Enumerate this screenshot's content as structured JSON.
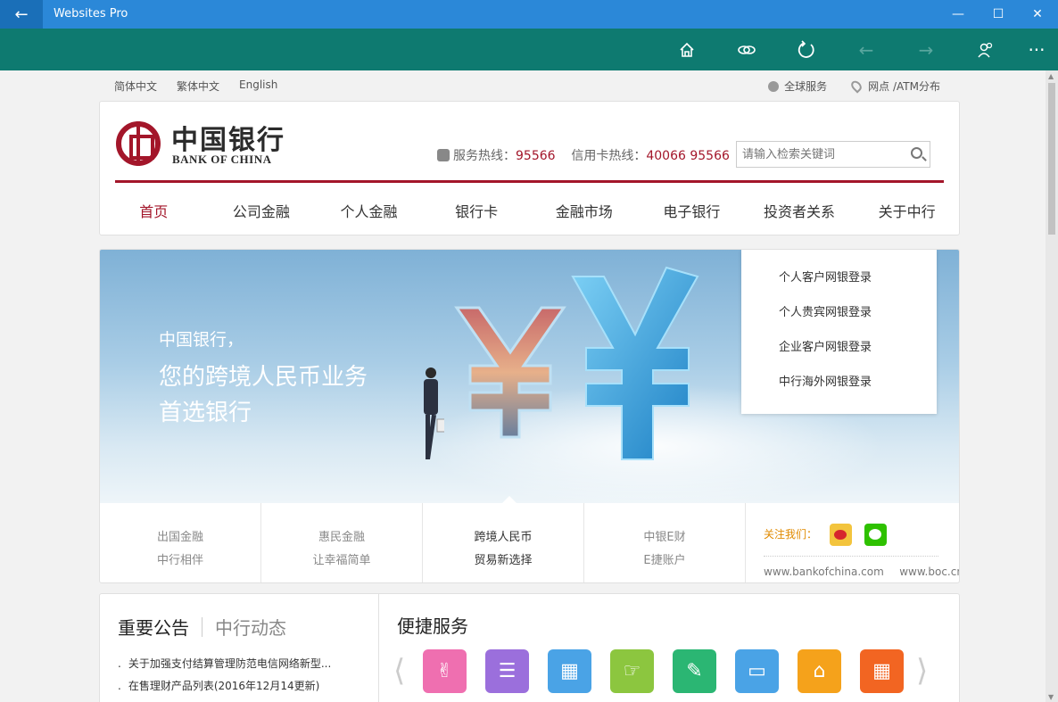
{
  "window": {
    "title": "Websites Pro"
  },
  "top_links": {
    "languages": [
      "简体中文",
      "繁体中文",
      "English"
    ],
    "global_service": "全球服务",
    "atm_branch": "网点 /ATM分布"
  },
  "header": {
    "logo_cn": "中国银行",
    "logo_en": "BANK OF CHINA",
    "hotline_label": "服务热线：",
    "hotline_number": "95566",
    "card_hotline_label": "信用卡热线：",
    "card_hotline_number": "40066 95566",
    "search_placeholder": "请输入检索关键词"
  },
  "nav": [
    "首页",
    "公司金融",
    "个人金融",
    "银行卡",
    "金融市场",
    "电子银行",
    "投资者关系",
    "关于中行"
  ],
  "banner": {
    "line1": "中国银行，",
    "line2": "您的跨境人民币业务",
    "line3": "首选银行"
  },
  "login_menu": [
    "个人客户网银登录",
    "个人贵宾网银登录",
    "企业客户网银登录",
    "中行海外网银登录"
  ],
  "quick_links": [
    {
      "l1": "出国金融",
      "l2": "中行相伴"
    },
    {
      "l1": "惠民金融",
      "l2": "让幸福简单"
    },
    {
      "l1": "跨境人民币",
      "l2": "贸易新选择"
    },
    {
      "l1": "中银E财",
      "l2": "E捷账户"
    }
  ],
  "follow": {
    "label": "关注我们：",
    "site1": "www.bankofchina.com",
    "site2": "www.boc.cn"
  },
  "news": {
    "tab_active": "重要公告",
    "tab_inactive": "中行动态",
    "items": [
      "关于加强支付结算管理防范电信网络新型...",
      "在售理财产品列表(2016年12月14更新)"
    ]
  },
  "services": {
    "title": "便捷服务",
    "icons": [
      {
        "name": "wealth-icon",
        "color": "#ef6fb0"
      },
      {
        "name": "document-icon",
        "color": "#9b6fdc"
      },
      {
        "name": "building-icon",
        "color": "#4aa3e6"
      },
      {
        "name": "hand-icon",
        "color": "#8cc63f"
      },
      {
        "name": "form-icon",
        "color": "#2bb673"
      },
      {
        "name": "card-icon",
        "color": "#4aa3e6"
      },
      {
        "name": "home-icon",
        "color": "#f5a21b"
      },
      {
        "name": "chart-icon",
        "color": "#f26522"
      }
    ]
  }
}
